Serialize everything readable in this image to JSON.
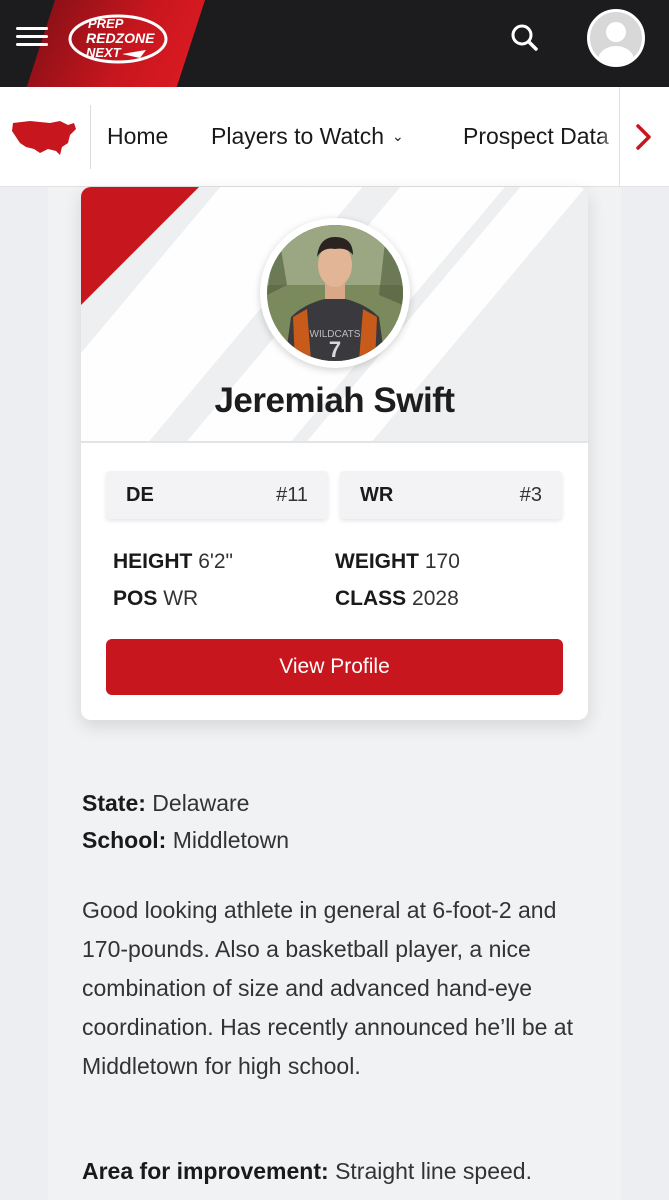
{
  "header": {
    "logo_text": "PREP REDZONE NEXT",
    "menu_icon": "hamburger-icon",
    "search_icon": "search-icon",
    "avatar_icon": "user-avatar-icon",
    "brand_color": "#c8161e"
  },
  "nav": {
    "items": [
      {
        "label": "Home"
      },
      {
        "label": "Players to Watch",
        "has_dropdown": true
      },
      {
        "label": "Prospect Data"
      }
    ],
    "map_icon": "usa-map-icon",
    "next_icon": "chevron-right-icon"
  },
  "player": {
    "name": "Jeremiah Swift",
    "positions": [
      {
        "pos": "DE",
        "number": "#11"
      },
      {
        "pos": "WR",
        "number": "#3"
      }
    ],
    "stats": {
      "height_label": "HEIGHT",
      "height_value": "6'2\"",
      "weight_label": "WEIGHT",
      "weight_value": "170",
      "pos_label": "POS",
      "pos_value": "WR",
      "class_label": "CLASS",
      "class_value": "2028"
    },
    "view_profile_label": "View Profile"
  },
  "article": {
    "state_label": "State:",
    "state_value": "Delaware",
    "school_label": "School:",
    "school_value": "Middletown",
    "bio": "Good looking athlete in general at 6-foot-2 and 170-pounds. Also a basketball player, a nice combination of size and advanced hand-eye coordination. Has recently announced he’ll be at Middletown for high school.",
    "improvement_label": "Area for improvement:",
    "improvement_value": "Straight line speed."
  }
}
